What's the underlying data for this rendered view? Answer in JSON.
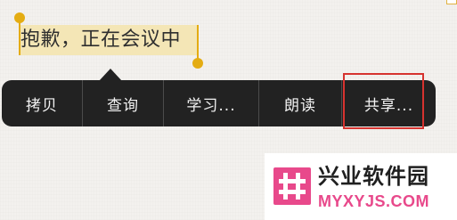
{
  "selection": {
    "text": "抱歉，正在会议中",
    "highlight_color": "#f4e6b6",
    "handle_color": "#e4ac12"
  },
  "context_menu": {
    "background": "#222222",
    "items": [
      {
        "label": "拷贝"
      },
      {
        "label": "查询"
      },
      {
        "label": "学习..."
      },
      {
        "label": "朗读"
      },
      {
        "label": "共享..."
      }
    ],
    "highlighted_item": "共享...",
    "highlight_color": "#d6332f"
  },
  "watermark": {
    "title": "兴业软件园",
    "domain": "MYXYJS.COM",
    "logo_color": "#e8498b",
    "logo_icon": "hash-icon"
  }
}
